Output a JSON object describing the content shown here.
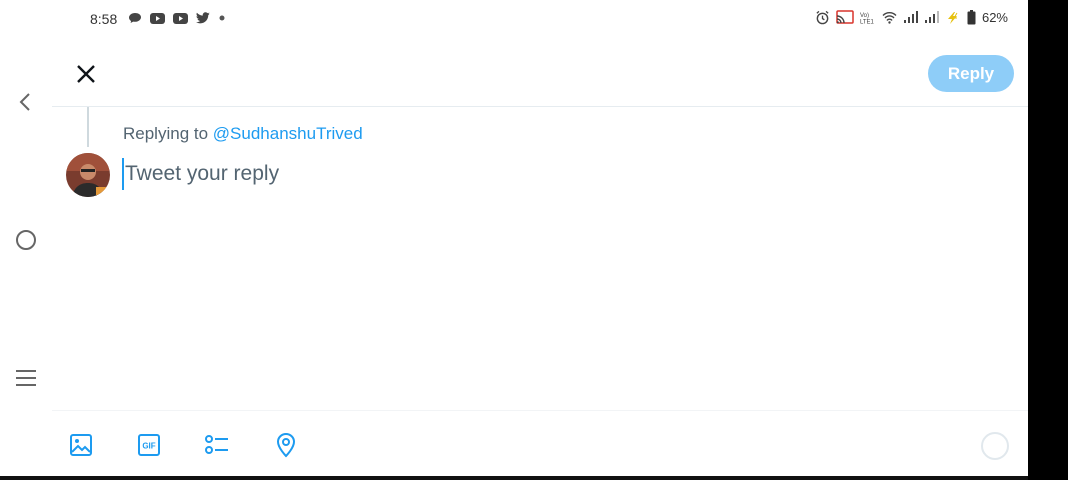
{
  "status_bar": {
    "time": "8:58",
    "battery": "62%",
    "left_icons": [
      "chat-bubble-icon",
      "youtube-icon",
      "youtube-icon",
      "twitter-icon",
      "dot-icon"
    ],
    "right_icons": [
      "alarm-icon",
      "cast-icon",
      "volte-icon",
      "wifi-icon",
      "signal-icon",
      "signal-icon",
      "charging-icon",
      "battery-icon"
    ]
  },
  "nav_rail": {
    "icons": [
      "back-chevron-icon",
      "home-circle-icon",
      "recent-apps-icon"
    ]
  },
  "header": {
    "reply_label": "Reply"
  },
  "compose": {
    "replying_prefix": "Replying to",
    "replying_handle": "@SudhanshuTrived",
    "placeholder": "Tweet your reply"
  },
  "toolbar": {
    "icons": [
      "image-icon",
      "gif-icon",
      "poll-icon",
      "location-icon"
    ],
    "gif_text": "GIF"
  },
  "colors": {
    "accent": "#1d9bf0",
    "reply_button_disabled": "#8ecdf8",
    "secondary_text": "#536471"
  }
}
